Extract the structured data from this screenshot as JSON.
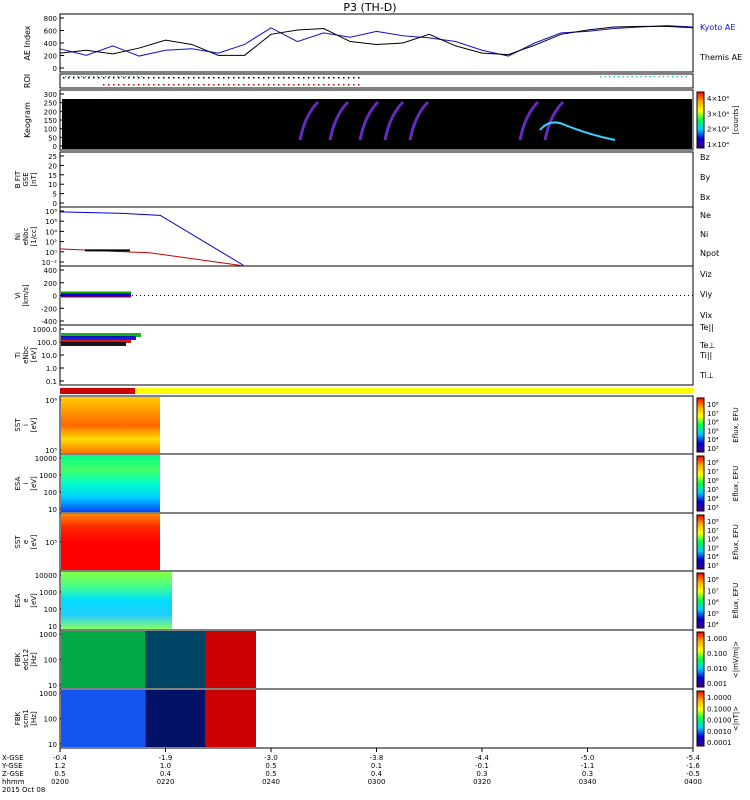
{
  "title": "P3 (TH-D)",
  "colors": {
    "kyoto": "#1010c8",
    "themis": "#000000",
    "bz": "#cc0000",
    "by": "#00aa00",
    "bx": "#0000cc",
    "ni_line": "#000000",
    "npot_line": "#0000cc",
    "ne_line": "#cc0000",
    "bar_red": "#cc0000",
    "bar_yellow": "#ffff00"
  },
  "panels": {
    "ae": {
      "ylabel": "AE Index",
      "ticks": [
        "800",
        "600",
        "400",
        "200",
        "0"
      ],
      "legend": [
        "Kyoto AE",
        "Themis AE"
      ]
    },
    "roi": {
      "ylabel": "ROI"
    },
    "keogram": {
      "ylabel": "Keogram",
      "ticks": [
        "300",
        "250",
        "200",
        "150",
        "100",
        "50",
        "0"
      ],
      "cbar_ticks": [
        "4×10⁴",
        "3×10⁴",
        "2×10⁴",
        "1×10⁴"
      ],
      "cbar_label": "[counts]"
    },
    "bfit": {
      "ylabel_lines": [
        "B FIT",
        "GSE",
        "[nT]"
      ],
      "ticks": [
        "25",
        "20",
        "15",
        "10",
        "5",
        "0"
      ],
      "legend": [
        "Bz",
        "By",
        "Bx"
      ]
    },
    "ni": {
      "ylabel_lines": [
        "Ni",
        "eNbc",
        "[1/cc]"
      ],
      "ticks": [
        "10⁸",
        "10⁶",
        "10⁴",
        "10²",
        "10⁰",
        "10⁻²"
      ],
      "legend": [
        "Ne",
        "Ni",
        "Npot"
      ]
    },
    "vi": {
      "ylabel_lines": [
        "Vi",
        "[km/s]"
      ],
      "ticks": [
        "400",
        "200",
        "0",
        "-200",
        "-400"
      ],
      "legend": [
        "Viz",
        "Viy",
        "Vix"
      ]
    },
    "ti": {
      "ylabel_lines": [
        "Ti",
        "eNbc",
        "[eV]"
      ],
      "ticks": [
        "1000.0",
        "100.0",
        "10.0",
        "1.0",
        "0.1"
      ],
      "legend": [
        "Te||",
        "Te⊥",
        "Ti||",
        "Ti⊥"
      ]
    },
    "sst_i": {
      "ylabel_lines": [
        "SST",
        "i",
        "[eV]"
      ],
      "ticks": [
        "10⁶",
        "10⁵"
      ],
      "cbar_ticks": [
        "10⁸",
        "10⁷",
        "10⁶",
        "10⁵",
        "10⁴",
        "10³"
      ],
      "cbar_label": "Eflux, EFU"
    },
    "esa_i": {
      "ylabel_lines": [
        "ESA",
        "i",
        "[eV]"
      ],
      "ticks": [
        "10000",
        "1000",
        "100",
        "10"
      ],
      "cbar_ticks": [
        "10⁸",
        "10⁷",
        "10⁶",
        "10⁵",
        "10⁴",
        "10³"
      ],
      "cbar_label": "Eflux, EFU"
    },
    "sst_e": {
      "ylabel_lines": [
        "SST",
        "e",
        "[eV]"
      ],
      "ticks": [
        "10⁵"
      ],
      "cbar_ticks": [
        "10⁸",
        "10⁷",
        "10⁶",
        "10⁵",
        "10⁴",
        "10³"
      ],
      "cbar_label": "Eflux, EFU"
    },
    "esa_e": {
      "ylabel_lines": [
        "ESA",
        "e",
        "[eV]"
      ],
      "ticks": [
        "10000",
        "1000",
        "100",
        "10"
      ],
      "cbar_ticks": [
        "10⁸",
        "10⁷",
        "10⁶",
        "10⁵",
        "10⁴"
      ],
      "cbar_label": "Eflux, EFU"
    },
    "fbk_e": {
      "ylabel_lines": [
        "FBK",
        "edc12",
        "[Hz]"
      ],
      "ticks": [
        "1000",
        "100",
        "10"
      ],
      "cbar_ticks": [
        "1.000",
        "0.100",
        "0.010",
        "0.001"
      ],
      "cbar_label": "<|mV/m|>"
    },
    "fbk_b": {
      "ylabel_lines": [
        "FBK",
        "scm1",
        "[Hz]"
      ],
      "ticks": [
        "1000",
        "100",
        "10"
      ],
      "cbar_ticks": [
        "1.0000",
        "0.1000",
        "0.0100",
        "0.0010",
        "0.0001"
      ],
      "cbar_label": "<|nT|>"
    }
  },
  "xaxis": {
    "row_labels": [
      "X-GSE",
      "Y-GSE",
      "Z-GSE",
      "hhmm",
      "2015 Oct 08"
    ],
    "columns": [
      [
        "-0.4",
        "1.2",
        "0.5",
        "0200"
      ],
      [
        "-1.9",
        "1.0",
        "0.4",
        "0220"
      ],
      [
        "-3.0",
        "0.5",
        "0.5",
        "0240"
      ],
      [
        "-3.8",
        "0.1",
        "0.4",
        "0300"
      ],
      [
        "-4.4",
        "-0.1",
        "0.3",
        "0320"
      ],
      [
        "-5.0",
        "-1.1",
        "0.3",
        "0340"
      ],
      [
        "-5.4",
        "-1.6",
        "-0.5",
        "0400"
      ]
    ]
  },
  "chart_data": [
    {
      "type": "line",
      "panel": "AE Index",
      "time_range": [
        "02:00",
        "04:00"
      ],
      "ylim": [
        0,
        800
      ],
      "series": [
        {
          "name": "Kyoto AE",
          "x": [
            "02:00",
            "02:05",
            "02:10",
            "02:15",
            "02:20",
            "02:25",
            "02:30",
            "02:35",
            "02:40",
            "02:45",
            "02:50",
            "02:55",
            "03:00",
            "03:05",
            "03:10",
            "03:15",
            "03:20",
            "03:25",
            "03:30",
            "03:35",
            "03:40",
            "03:45",
            "03:50",
            "03:55",
            "04:00"
          ],
          "values": [
            320,
            230,
            360,
            220,
            300,
            320,
            260,
            380,
            610,
            420,
            540,
            480,
            560,
            500,
            470,
            420,
            300,
            220,
            400,
            540,
            560,
            600,
            620,
            640,
            620
          ]
        },
        {
          "name": "Themis AE",
          "x": [
            "02:00",
            "02:05",
            "02:10",
            "02:15",
            "02:20",
            "02:25",
            "02:30",
            "02:35",
            "02:40",
            "02:45",
            "02:50",
            "02:55",
            "03:00",
            "03:05",
            "03:10",
            "03:15",
            "03:20",
            "03:25",
            "03:30",
            "03:35",
            "03:40",
            "03:45",
            "03:50",
            "03:55",
            "04:00"
          ],
          "values": [
            260,
            300,
            250,
            330,
            440,
            380,
            230,
            230,
            520,
            580,
            600,
            420,
            380,
            400,
            520,
            360,
            260,
            240,
            370,
            520,
            580,
            620,
            630,
            630,
            610
          ]
        }
      ]
    },
    {
      "type": "line",
      "panel": "Ni",
      "ylog": true,
      "series": [
        {
          "name": "Npot",
          "x": [
            "02:00",
            "02:12",
            "02:19",
            "02:35"
          ],
          "values": [
            100000000,
            50000000,
            20000000,
            0.001
          ]
        },
        {
          "name": "Ne",
          "x": [
            "02:00",
            "02:10",
            "02:17",
            "02:35"
          ],
          "values": [
            3,
            1,
            0.5,
            0.001
          ]
        }
      ]
    }
  ]
}
